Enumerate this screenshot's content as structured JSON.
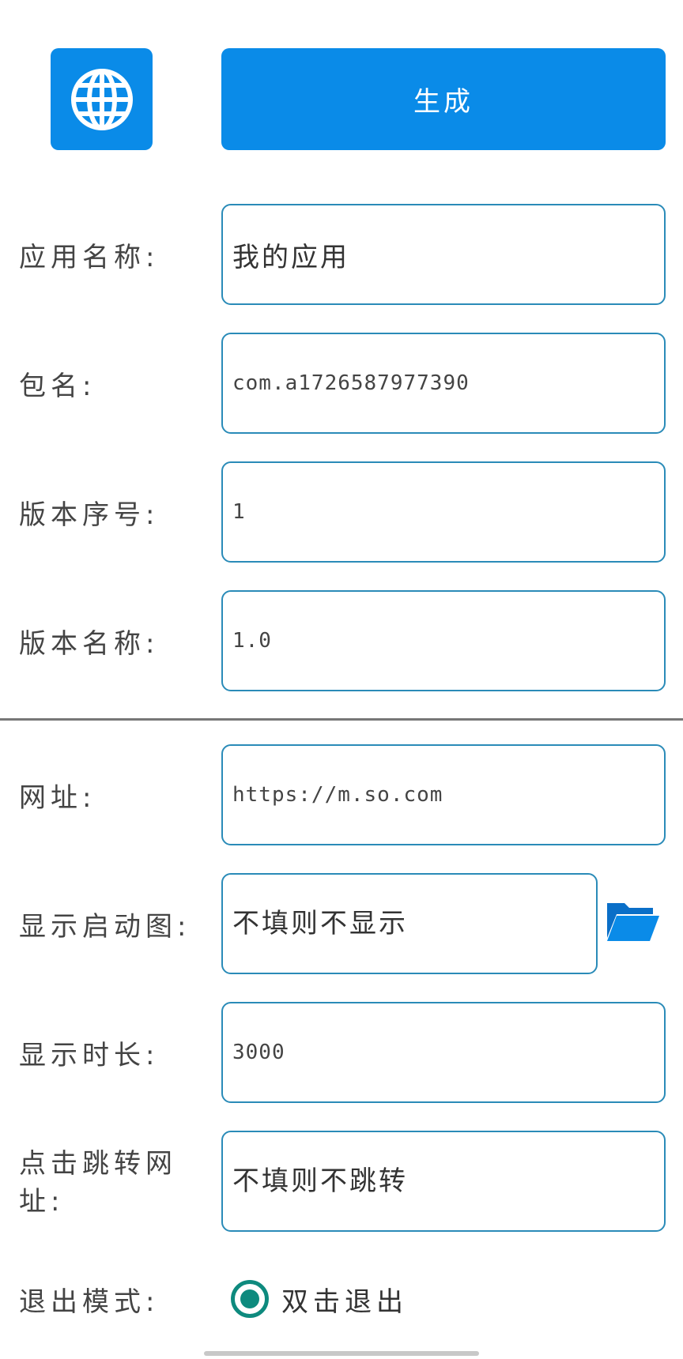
{
  "toolbar": {
    "globe_icon": "globe-icon",
    "generate_label": "生成"
  },
  "form": {
    "app_name": {
      "label": "应用名称:",
      "value": "我的应用"
    },
    "package_name": {
      "label": "包名:",
      "value": "com.a1726587977390"
    },
    "version_code": {
      "label": "版本序号:",
      "value": "1"
    },
    "version_name": {
      "label": "版本名称:",
      "value": "1.0"
    },
    "url": {
      "label": "网址:",
      "value": "https://m.so.com"
    },
    "splash_image": {
      "label": "显示启动图:",
      "placeholder": "不填则不显示",
      "icon": "folder-open-icon"
    },
    "display_duration": {
      "label": "显示时长:",
      "value": "3000"
    },
    "click_jump_url": {
      "label": "点击跳转网址:",
      "placeholder": "不填则不跳转"
    },
    "exit_mode": {
      "label": "退出模式:",
      "selected_option": "双击退出"
    }
  },
  "colors": {
    "accent": "#0a8be8",
    "field_border": "#2a8bb8",
    "radio": "#0e8a7e"
  }
}
